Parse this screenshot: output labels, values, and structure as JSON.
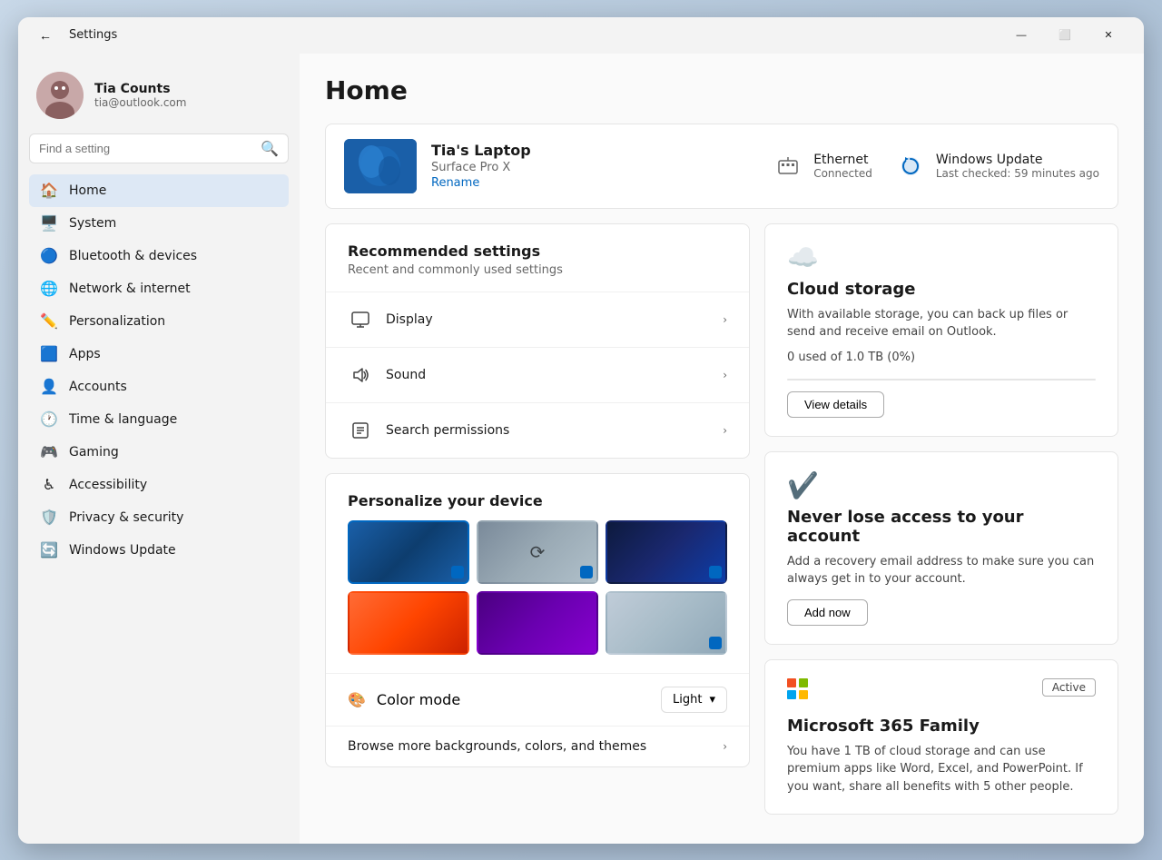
{
  "window": {
    "title": "Settings",
    "min_label": "—",
    "max_label": "⬜",
    "close_label": "✕"
  },
  "sidebar": {
    "search_placeholder": "Find a setting",
    "user": {
      "name": "Tia Counts",
      "email": "tia@outlook.com",
      "avatar_emoji": "🧑"
    },
    "nav_items": [
      {
        "id": "home",
        "label": "Home",
        "icon": "🏠",
        "active": true
      },
      {
        "id": "system",
        "label": "System",
        "icon": "🖥️",
        "active": false
      },
      {
        "id": "bluetooth",
        "label": "Bluetooth & devices",
        "icon": "🔵",
        "active": false
      },
      {
        "id": "network",
        "label": "Network & internet",
        "icon": "🌐",
        "active": false
      },
      {
        "id": "personalization",
        "label": "Personalization",
        "icon": "✏️",
        "active": false
      },
      {
        "id": "apps",
        "label": "Apps",
        "icon": "🟦",
        "active": false
      },
      {
        "id": "accounts",
        "label": "Accounts",
        "icon": "👤",
        "active": false
      },
      {
        "id": "time",
        "label": "Time & language",
        "icon": "🕐",
        "active": false
      },
      {
        "id": "gaming",
        "label": "Gaming",
        "icon": "🎮",
        "active": false
      },
      {
        "id": "accessibility",
        "label": "Accessibility",
        "icon": "♿",
        "active": false
      },
      {
        "id": "privacy",
        "label": "Privacy & security",
        "icon": "🛡️",
        "active": false
      },
      {
        "id": "update",
        "label": "Windows Update",
        "icon": "🔄",
        "active": false
      }
    ]
  },
  "main": {
    "page_title": "Home",
    "device": {
      "name": "Tia's Laptop",
      "model": "Surface Pro X",
      "rename_label": "Rename"
    },
    "status": [
      {
        "id": "ethernet",
        "label": "Ethernet",
        "value": "Connected",
        "icon": "🖧"
      },
      {
        "id": "windows-update",
        "label": "Windows Update",
        "value": "Last checked: 59 minutes ago",
        "icon": "🔄"
      }
    ],
    "recommended": {
      "title": "Recommended settings",
      "subtitle": "Recent and commonly used settings",
      "items": [
        {
          "id": "display",
          "label": "Display",
          "icon": "🖥"
        },
        {
          "id": "sound",
          "label": "Sound",
          "icon": "🔊"
        },
        {
          "id": "search-permissions",
          "label": "Search permissions",
          "icon": "📋"
        }
      ]
    },
    "personalize": {
      "title": "Personalize your device",
      "wallpapers": [
        {
          "id": "wp1",
          "class": "wp1",
          "selected": true
        },
        {
          "id": "wp2",
          "class": "wp2",
          "selected": false
        },
        {
          "id": "wp3",
          "class": "wp3",
          "selected": false
        },
        {
          "id": "wp4",
          "class": "wp4",
          "selected": false
        },
        {
          "id": "wp5",
          "class": "wp5",
          "selected": false
        },
        {
          "id": "wp6",
          "class": "wp6",
          "selected": false
        }
      ],
      "color_mode_label": "Color mode",
      "color_mode_value": "Light",
      "browse_label": "Browse more backgrounds, colors, and themes"
    },
    "right_cards": {
      "cloud": {
        "title": "Cloud storage",
        "desc": "With available storage, you can back up files or send and receive email on Outlook.",
        "storage_text": "0 used of 1.0 TB (0%)",
        "btn_label": "View details"
      },
      "account": {
        "title": "Never lose access to your account",
        "desc": "Add a recovery email address to make sure you can always get in to your account.",
        "btn_label": "Add now"
      },
      "ms365": {
        "title": "Microsoft 365 Family",
        "desc": "You have 1 TB of cloud storage and can use premium apps like Word, Excel, and PowerPoint. If you want, share all benefits with 5 other people.",
        "badge": "Active"
      }
    }
  }
}
